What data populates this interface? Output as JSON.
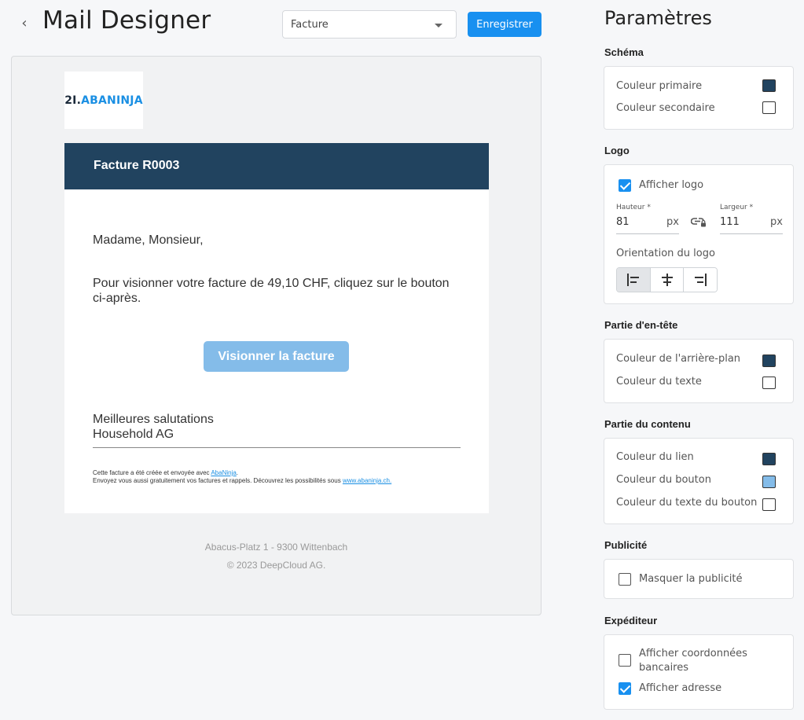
{
  "header": {
    "title": "Mail Designer",
    "template_select": "Facture",
    "save_label": "Enregistrer"
  },
  "email": {
    "logo_num": "2I.",
    "logo_brand": "ABANINJA",
    "header_title": "Facture R0003",
    "greeting": "Madame, Monsieur,",
    "paragraph": "Pour visionner votre facture de 49,10 CHF, cliquez sur le bouton ci-après.",
    "button_label": "Visionner la facture",
    "regards_line1": "Meilleures salutations",
    "regards_line2": "Household AG",
    "fine_line1_prefix": "Cette facture a été créée et envoyée avec ",
    "fine_link1": "AbaNinja",
    "fine_line1_suffix": ".",
    "fine_line2_prefix": "Envoyez vous aussi gratuitement vos factures et rappels. Découvrez les possibilités sous ",
    "fine_link2": "www.abaninja.ch.",
    "address": "Abacus-Platz 1 - 9300 Wittenbach",
    "copyright": "© 2023 DeepCloud AG."
  },
  "settings": {
    "title": "Paramètres",
    "schema": {
      "title": "Schéma",
      "primary_label": "Couleur primaire",
      "primary_color": "#21435f",
      "secondary_label": "Couleur secondaire",
      "secondary_color": "#ffffff"
    },
    "logo": {
      "title": "Logo",
      "show_label": "Afficher logo",
      "show_checked": true,
      "height_label": "Hauteur *",
      "height_value": "81",
      "width_label": "Largeur *",
      "width_value": "111",
      "unit": "px",
      "orientation_label": "Orientation du logo",
      "orientation_selected": "left"
    },
    "header_part": {
      "title": "Partie d'en-tête",
      "bg_label": "Couleur de l'arrière-plan",
      "bg_color": "#21435f",
      "text_label": "Couleur du texte",
      "text_color": "#ffffff"
    },
    "content_part": {
      "title": "Partie du contenu",
      "link_label": "Couleur du lien",
      "link_color": "#21435f",
      "button_label": "Couleur du bouton",
      "button_color": "#84bce9",
      "button_text_label": "Couleur du texte du bouton",
      "button_text_color": "#ffffff"
    },
    "ads": {
      "title": "Publicité",
      "hide_label": "Masquer la publicité",
      "hide_checked": false
    },
    "sender": {
      "title": "Expéditeur",
      "bank_label": "Afficher coordonnées bancaires",
      "bank_checked": false,
      "address_label": "Afficher adresse",
      "address_checked": true
    }
  }
}
